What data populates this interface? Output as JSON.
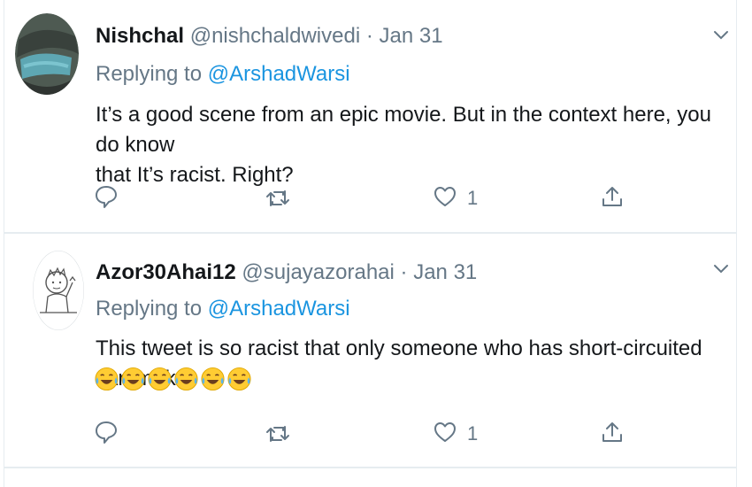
{
  "tweets": [
    {
      "name": "Nishchal",
      "handle": "@nishchaldwivedi",
      "separator": "·",
      "date": "Jan 31",
      "replying_prefix": "Replying to",
      "replying_to": "@ArshadWarsi",
      "text_line1": "It’s a good scene from an epic movie. But in the context here, you do know",
      "text_line2": "that It’s racist. Right?",
      "like_count": "1",
      "icons": [
        "reply-icon",
        "retweet-icon",
        "heart-icon",
        "share-icon",
        "chevron-down-icon"
      ]
    },
    {
      "name": "Azor30Ahai12",
      "handle": "@sujayazorahai",
      "separator": "·",
      "date": "Jan 31",
      "replying_prefix": "Replying to",
      "replying_to": "@ArshadWarsi",
      "text_line1": "This tweet is so racist that only someone who has short-circuited can make.",
      "emoji_count": 6,
      "emoji": "face-with-tears-of-joy",
      "like_count": "1",
      "icons": [
        "reply-icon",
        "retweet-icon",
        "heart-icon",
        "share-icon",
        "chevron-down-icon"
      ]
    }
  ],
  "colors": {
    "link": "#1b95e0",
    "secondary_text": "#657786",
    "primary_text": "#14171a",
    "divider": "#e6ecf0"
  }
}
